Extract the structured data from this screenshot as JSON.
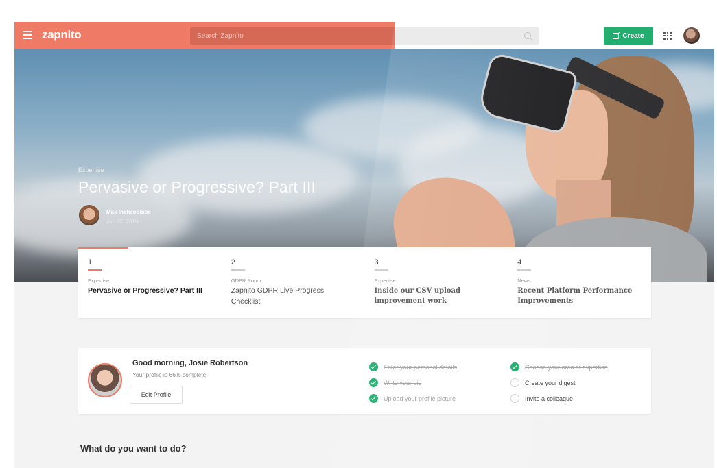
{
  "header": {
    "logo": "zapnito",
    "search_placeholder": "Search Zapnito",
    "create_label": "Create",
    "accent_color": "#ef7a66",
    "create_color": "#1bab6a"
  },
  "hero": {
    "category": "Expertise",
    "title": "Pervasive or Progressive? Part III",
    "author": "Max Inchcoombe",
    "date": "Jun 03, 2019"
  },
  "featured": [
    {
      "number": "1",
      "category": "Expertise",
      "title": "Pervasive or Progressive? Part III"
    },
    {
      "number": "2",
      "category": "GDPR Room",
      "title": "Zapnito GDPR Live Progress Checklist"
    },
    {
      "number": "3",
      "category": "Expertise",
      "title": "Inside our CSV upload improvement work"
    },
    {
      "number": "4",
      "category": "News",
      "title": "Recent Platform Performance Improvements"
    }
  ],
  "profile": {
    "greeting": "Good morning, Josie Robertson",
    "completion_text": "Your profile is 66% complete",
    "completion": 66,
    "edit_label": "Edit Profile",
    "tasks_left": [
      {
        "label": "Enter your personal details",
        "done": true
      },
      {
        "label": "Write your bio",
        "done": true
      },
      {
        "label": "Upload your profile picture",
        "done": true
      }
    ],
    "tasks_right": [
      {
        "label": "Choose your area of expertise",
        "done": true
      },
      {
        "label": "Create your digest",
        "done": false
      },
      {
        "label": "Invite a colleague",
        "done": false
      }
    ]
  },
  "section": {
    "what_title": "What do you want to do?"
  },
  "icons": [
    "hamburger-icon",
    "search-icon",
    "create-icon",
    "apps-grid-icon",
    "check-icon"
  ]
}
